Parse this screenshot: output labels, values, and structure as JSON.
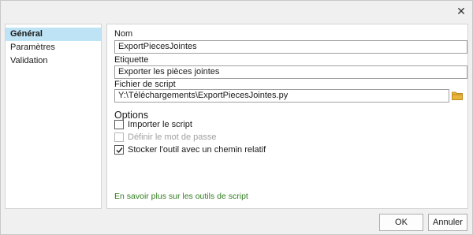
{
  "window": {
    "close_glyph": "✕"
  },
  "sidebar": {
    "items": [
      {
        "label": "Général",
        "active": true
      },
      {
        "label": "Paramètres",
        "active": false
      },
      {
        "label": "Validation",
        "active": false
      }
    ]
  },
  "form": {
    "name_label": "Nom",
    "name_value": "ExportPiecesJointes",
    "label_label": "Etiquette",
    "label_value": "Exporter les pièces jointes",
    "script_label": "Fichier de script",
    "script_value": "Y:\\Téléchargements\\ExportPiecesJointes.py",
    "folder_icon_color": "#e8b43c"
  },
  "options": {
    "title": "Options",
    "items": [
      {
        "label": "Importer le script",
        "checked": false,
        "disabled": false
      },
      {
        "label": "Définir le mot de passe",
        "checked": false,
        "disabled": true
      },
      {
        "label": "Stocker l'outil avec un chemin relatif",
        "checked": true,
        "disabled": false
      }
    ]
  },
  "help_link": "En savoir plus sur les outils de script",
  "buttons": {
    "ok": "OK",
    "cancel": "Annuler"
  },
  "colors": {
    "selection": "#bde3f5",
    "link": "#2f7d1f"
  }
}
